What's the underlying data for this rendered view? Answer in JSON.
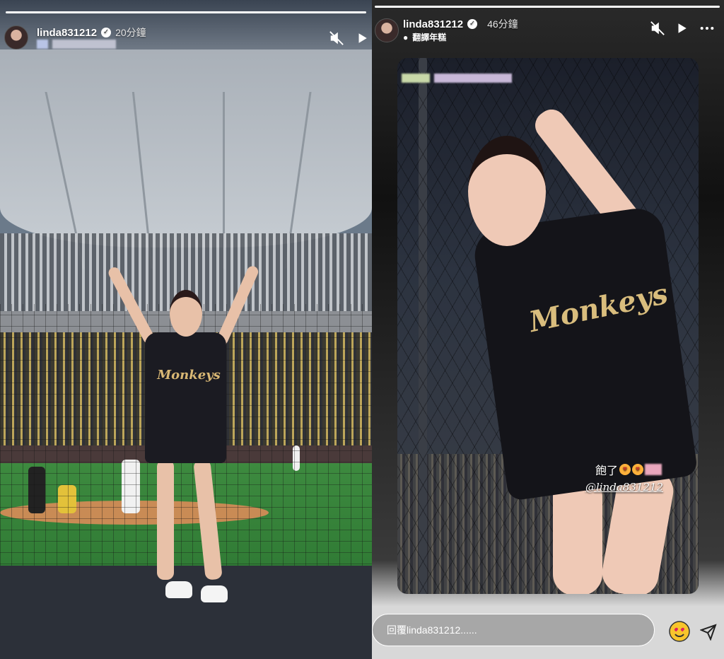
{
  "left_story": {
    "username": "linda831212",
    "time_ago": "20分鐘",
    "jersey_text": "Monkeys"
  },
  "right_story": {
    "username": "linda831212",
    "time_ago": "46分鐘",
    "translate_label": "翻譯年糕",
    "jersey_text": "Monkeys",
    "sticker_text": "飽了",
    "mention": "@linda831212",
    "reply_placeholder": "回覆linda831212......"
  },
  "icons": {
    "verified": "verified-check-icon",
    "muted": "speaker-muted-icon",
    "play": "play-icon",
    "more": "more-icon",
    "reaction": "heart-eyes-emoji-icon",
    "send": "send-icon"
  },
  "colors": {
    "progress_bar": "#ffffff",
    "emoji_yellow": "#ffb13b",
    "jersey_gold": "#d8b774"
  }
}
